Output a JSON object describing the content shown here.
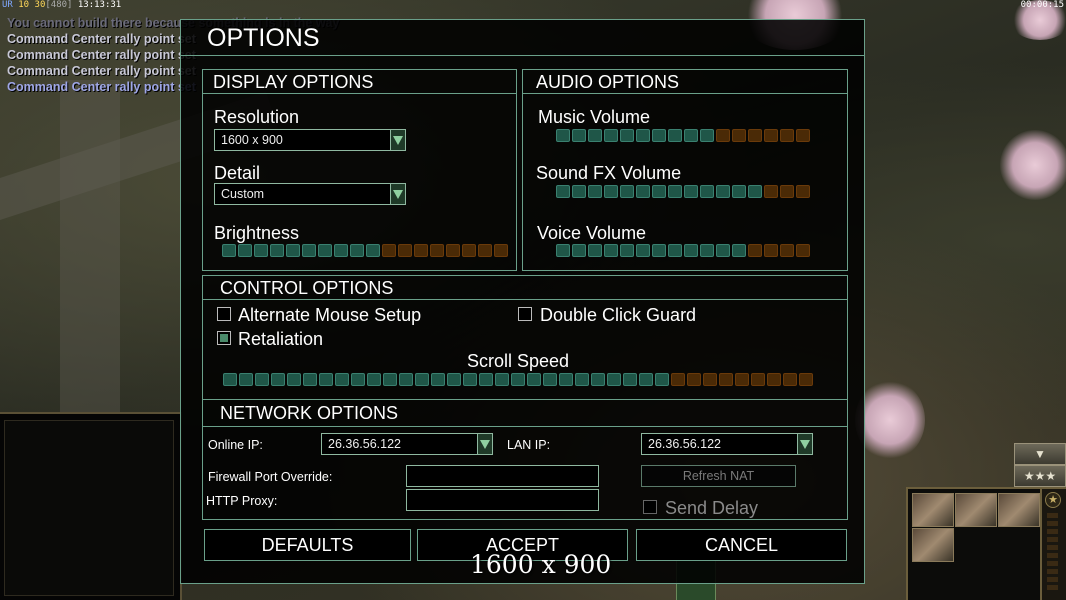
{
  "hud": {
    "ur": "UR",
    "fps": "10 30",
    "latency": "[480]",
    "clock": "13:13:31",
    "timer": "00:00:15"
  },
  "chat": [
    "You cannot build there because something is in the way",
    "Command Center rally point set",
    "Command Center rally point set",
    "Command Center rally point set",
    "Command Center rally point set"
  ],
  "dialog": {
    "title": "OPTIONS",
    "display": {
      "title": "DISPLAY OPTIONS",
      "resolution_label": "Resolution",
      "resolution_value": "1600 x 900",
      "detail_label": "Detail",
      "detail_value": "Custom",
      "brightness_label": "Brightness",
      "brightness_level": 0.55,
      "brightness_segments": 18
    },
    "audio": {
      "title": "AUDIO OPTIONS",
      "music_label": "Music Volume",
      "music_level": 0.6,
      "sfx_label": "Sound FX Volume",
      "sfx_level": 0.8,
      "voice_label": "Voice Volume",
      "voice_level": 0.75,
      "segments": 16
    },
    "control": {
      "title": "CONTROL OPTIONS",
      "alt_mouse_label": "Alternate Mouse Setup",
      "alt_mouse_checked": false,
      "double_click_label": "Double Click Guard",
      "double_click_checked": false,
      "retaliation_label": "Retaliation",
      "retaliation_checked": true,
      "scroll_label": "Scroll Speed",
      "scroll_level": 0.77,
      "scroll_segments": 37
    },
    "network": {
      "title": "NETWORK OPTIONS",
      "online_ip_label": "Online IP:",
      "online_ip_value": "26.36.56.122",
      "lan_ip_label": "LAN IP:",
      "lan_ip_value": "26.36.56.122",
      "firewall_label": "Firewall Port Override:",
      "firewall_value": "",
      "proxy_label": "HTTP Proxy:",
      "proxy_value": "",
      "refresh_nat_label": "Refresh NAT",
      "send_delay_label": "Send Delay",
      "send_delay_checked": false
    },
    "buttons": {
      "defaults": "DEFAULTS",
      "accept": "ACCEPT",
      "cancel": "CANCEL"
    },
    "resolution_overlay": "1600 x 900"
  },
  "colors": {
    "panel_border": "#6aa08a",
    "slider_on": "#1f5648",
    "slider_off": "#4a2a06"
  },
  "icons": {
    "dropdown": "chevron-down-icon",
    "rank": "star-icon"
  }
}
